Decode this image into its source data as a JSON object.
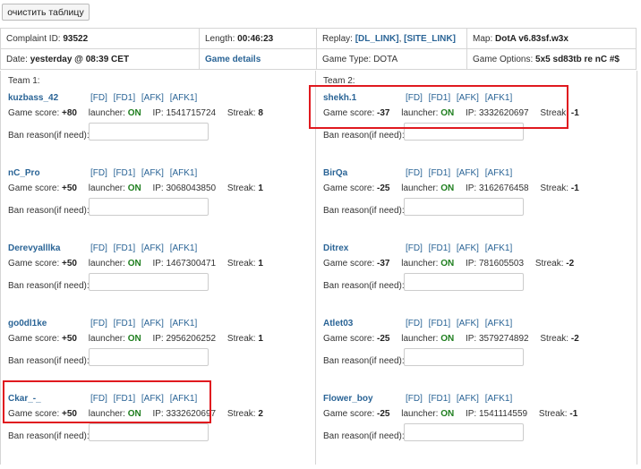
{
  "toolbar": {
    "clear_label": "очистить таблицу"
  },
  "info": {
    "complaint_label": "Complaint ID:",
    "complaint_value": "93522",
    "length_label": "Length:",
    "length_value": "00:46:23",
    "replay_label": "Replay:",
    "replay_dl": "[DL_LINK]",
    "replay_site": "[SITE_LINK]",
    "map_label": "Map:",
    "map_value": "DotA v6.83sf.w3x",
    "date_label": "Date:",
    "date_value": "yesterday @ 08:39 CET",
    "game_details": "Game details",
    "type_label": "Game Type:",
    "type_value": "DOTA",
    "options_label": "Game Options:",
    "options_value": "5x5 sd83tb re nC #$"
  },
  "labels": {
    "score": "Game score:",
    "launcher": "launcher:",
    "ip": "IP:",
    "streak": "Streak:",
    "ban": "Ban reason(if need):",
    "fd": "[FD]",
    "fd1": "[FD1]",
    "afk": "[AFK]",
    "afk1": "[AFK1]"
  },
  "team1": {
    "title": "Team 1:",
    "players": [
      {
        "name": "kuzbass_42",
        "score": "+80",
        "launcher": "ON",
        "ip": "1541715724",
        "streak": "8"
      },
      {
        "name": "nC_Pro",
        "score": "+50",
        "launcher": "ON",
        "ip": "3068043850",
        "streak": "1"
      },
      {
        "name": "Derevyalllka",
        "score": "+50",
        "launcher": "ON",
        "ip": "1467300471",
        "streak": "1"
      },
      {
        "name": "go0dl1ke",
        "score": "+50",
        "launcher": "ON",
        "ip": "2956206252",
        "streak": "1"
      },
      {
        "name": "Ckar_-_",
        "score": "+50",
        "launcher": "ON",
        "ip": "3332620697",
        "streak": "2"
      }
    ]
  },
  "team2": {
    "title": "Team 2:",
    "players": [
      {
        "name": "shekh.1",
        "score": "-37",
        "launcher": "ON",
        "ip": "3332620697",
        "streak": "-1"
      },
      {
        "name": "BirQa",
        "score": "-25",
        "launcher": "ON",
        "ip": "3162676458",
        "streak": "-1"
      },
      {
        "name": "Ditrex",
        "score": "-37",
        "launcher": "ON",
        "ip": "781605503",
        "streak": "-2"
      },
      {
        "name": "Atlet03",
        "score": "-25",
        "launcher": "ON",
        "ip": "3579274892",
        "streak": "-2"
      },
      {
        "name": "Flower_boy",
        "score": "-25",
        "launcher": "ON",
        "ip": "1541114559",
        "streak": "-1"
      }
    ]
  },
  "colors": {
    "link": "#2a6496",
    "on": "#1e7e1e",
    "highlight": "#e0191f"
  }
}
